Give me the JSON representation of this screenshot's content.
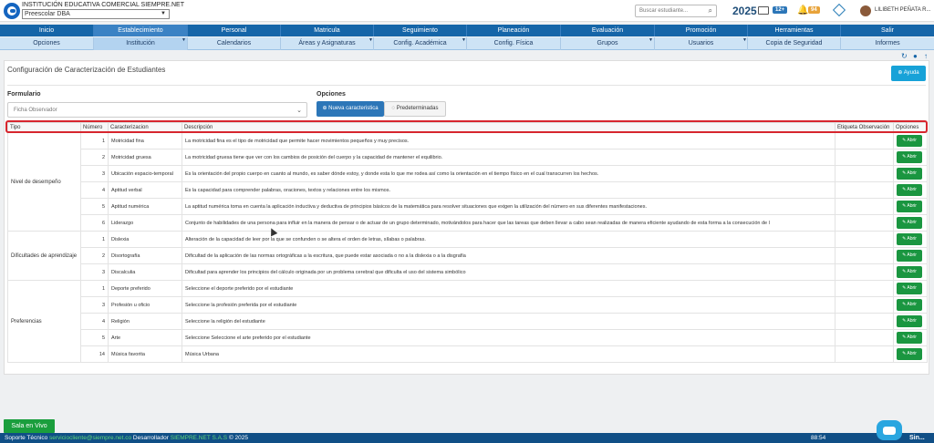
{
  "header": {
    "institution": "INSTITUCIÓN EDUCATIVA COMERCIAL SIEMPRE.NET",
    "school_select": "Preescolar DBA",
    "search_placeholder": "Buscar estudiante...",
    "year": "2025",
    "mail_badge": "12+",
    "notif_badge": "94",
    "user_name": "LILIBETH PEÑATA R..."
  },
  "nav_main": [
    "Inicio",
    "Establecimiento",
    "Personal",
    "Matricula",
    "Seguimiento",
    "Planeación",
    "Evaluación",
    "Promoción",
    "Herramientas",
    "Salir"
  ],
  "nav_sub": [
    "Opciones",
    "Institución",
    "Calendarios",
    "Áreas y Asignaturas",
    "Config. Académica",
    "Config. Física",
    "Grupos",
    "Usuarios",
    "Copia de Seguridad",
    "Informes"
  ],
  "page": {
    "title": "Configuración de Caracterización de Estudiantes",
    "help_label": "Ayuda",
    "form_label": "Formulario",
    "form_value": "Ficha Observador",
    "options_label": "Opciones",
    "new_btn": "Nueva caracteristica",
    "predef_btn": "Predeterminadas"
  },
  "table": {
    "headers": [
      "Tipo",
      "Número",
      "Caracterizacion",
      "Descripción",
      "Etiqueta Observación",
      "Opciones"
    ],
    "open_label": "Abrir",
    "groups": [
      {
        "tipo": "Nivel de desempeño",
        "rows": [
          {
            "num": "1",
            "car": "Motricidad fina",
            "desc": "La motricidad fina es el tipo de motricidad que permite hacer movimientos pequeños y muy precisos."
          },
          {
            "num": "2",
            "car": "Motricidad gruesa",
            "desc": "La motricidad gruesa tiene que ver con los cambios de posición del cuerpo y la capacidad de mantener el equilibrio."
          },
          {
            "num": "3",
            "car": "Ubicación espacio-temporal",
            "desc": "Es la orientación del propio cuerpo en cuanto al mundo, es saber dónde estoy, y donde esta lo que me rodea así como la orientación en el tiempo físico en el cual transcurren los hechos."
          },
          {
            "num": "4",
            "car": "Aptitud verbal",
            "desc": "Es la capacidad para comprender palabras, oraciones, textos y relaciones entre los mismos."
          },
          {
            "num": "5",
            "car": "Aptitud numérica",
            "desc": "La aptitud numérica toma en cuenta la aplicación inductiva y deductiva de principios básicos de la matemática para resolver situaciones que exigen la utilización del número en sus diferentes manifestaciones."
          },
          {
            "num": "6",
            "car": "Liderazgo",
            "desc": "Conjunto de habilidades de una persona para influir en la manera de pensar o de actuar de un grupo determinado, motivándolos para hacer que las tareas que deben llevar a cabo sean realizadas de manera eficiente ayudando de esta forma a la consecución de l"
          }
        ]
      },
      {
        "tipo": "Dificultades de aprendizaje",
        "rows": [
          {
            "num": "1",
            "car": "Dislexia",
            "desc": "Alteración de la capacidad de leer por la que se confunden o se altera el orden de letras, sílabas o palabras."
          },
          {
            "num": "2",
            "car": "Disortografía",
            "desc": "Dificultad de la aplicación de las normas ortográficas a la escritura, que puede estar asociada o no a la dislexia o a la disgrafía"
          },
          {
            "num": "3",
            "car": "Discalculia",
            "desc": "Dificultad para aprender los principios del cálculo originada por un problema cerebral que dificulta el uso del sistema simbólico"
          }
        ]
      },
      {
        "tipo": "Preferencias",
        "rows": [
          {
            "num": "1",
            "car": "Deporte preferido",
            "desc": "Seleccione el deporte preferido por el estudiante"
          },
          {
            "num": "3",
            "car": "Profesión u oficio",
            "desc": "Seleccione la profesión preferida por el estudiante"
          },
          {
            "num": "4",
            "car": "Religión",
            "desc": "Seleccione la religión del estudiante"
          },
          {
            "num": "5",
            "car": "Arte",
            "desc": "Seleccione Seleccione el arte preferido por el estudiante"
          },
          {
            "num": "14",
            "car": "Música favorita",
            "desc": "Música Urbana"
          }
        ]
      }
    ]
  },
  "footer": {
    "live_btn": "Sala en Vivo",
    "support_label": "Soporte Técnico",
    "support_email": "serviciocliente@siempre.net.co",
    "dev_label": "Desarrollador",
    "dev_name": "SIEMPRE.NET S.A.S",
    "copyright": "© 2025",
    "time": "88:54",
    "brand_short": "Sin..."
  }
}
